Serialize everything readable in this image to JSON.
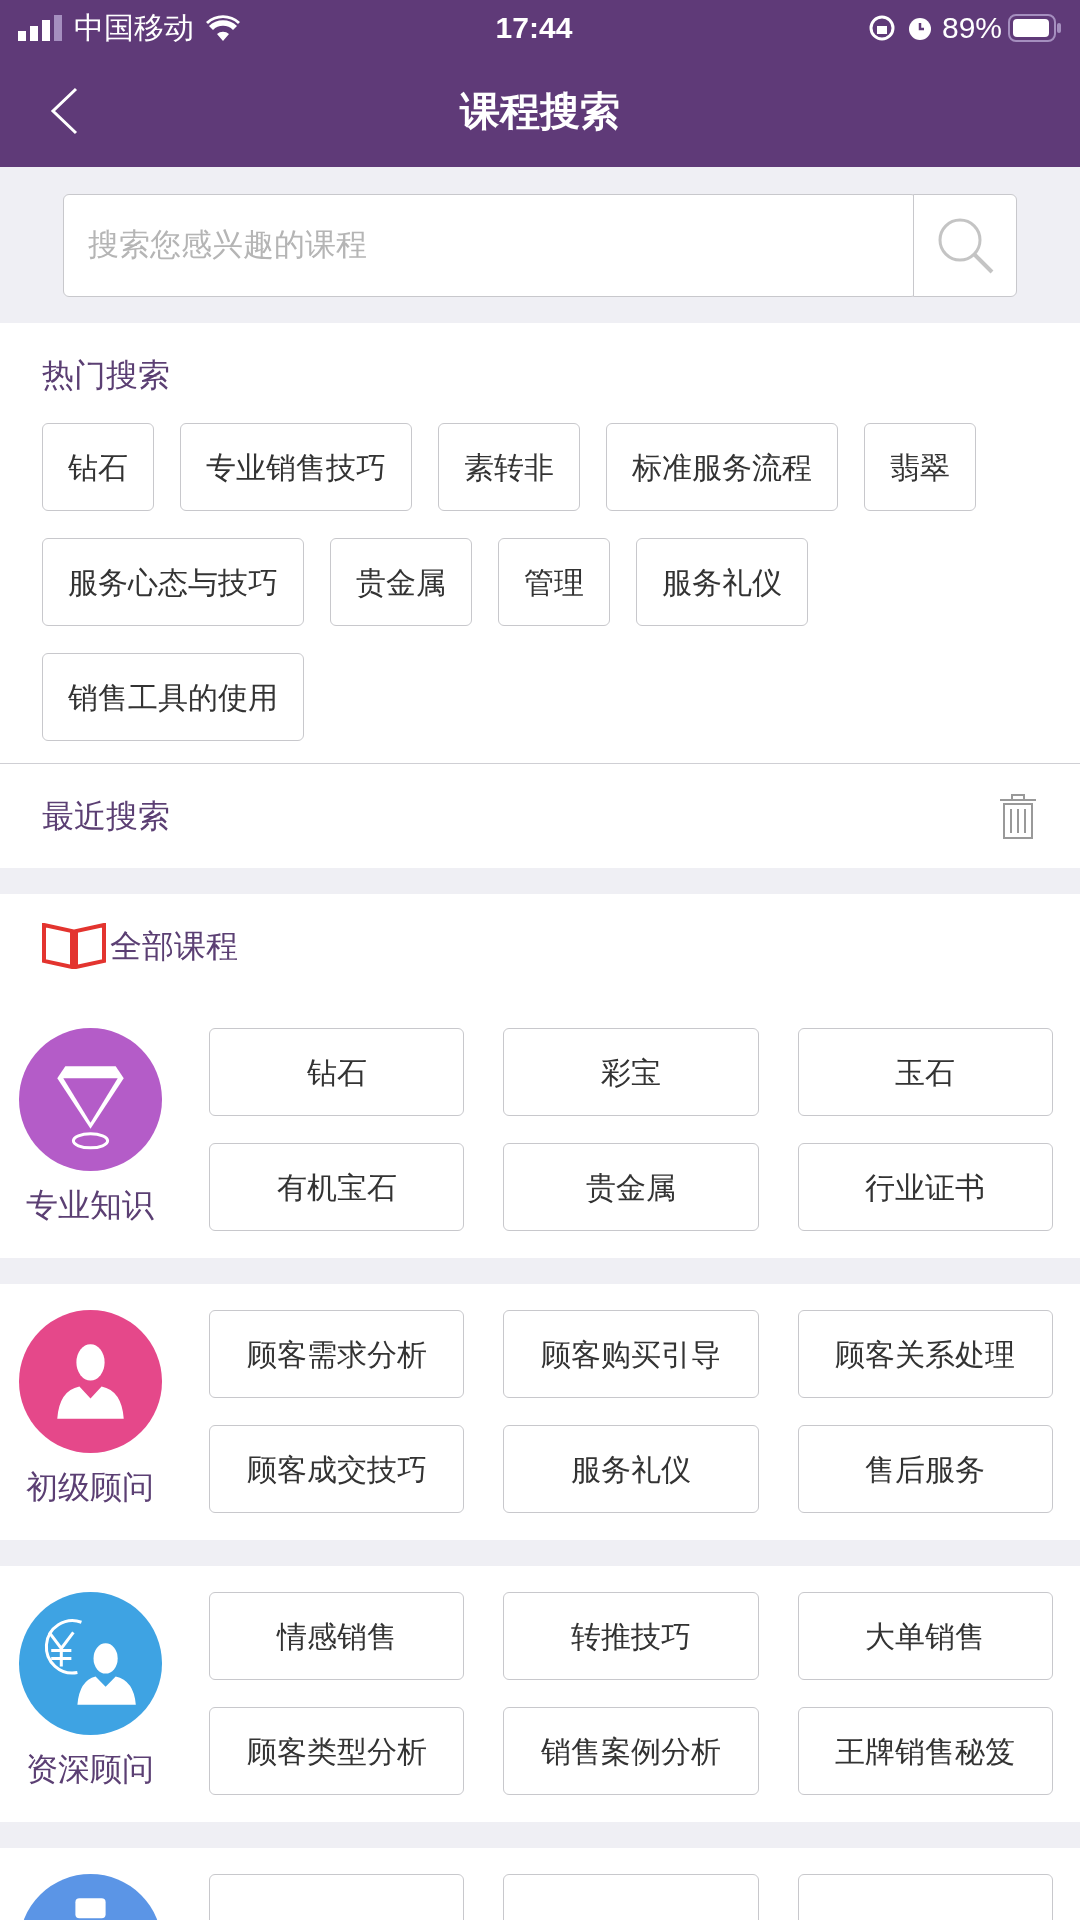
{
  "status_bar": {
    "carrier": "中国移动",
    "time": "17:44",
    "battery": "89%"
  },
  "nav": {
    "title": "课程搜索"
  },
  "search": {
    "placeholder": "搜索您感兴趣的课程"
  },
  "hot_search": {
    "title": "热门搜索",
    "tags": [
      "钻石",
      "专业销售技巧",
      "素转非",
      "标准服务流程",
      "翡翠",
      "服务心态与技巧",
      "贵金属",
      "管理",
      "服务礼仪",
      "销售工具的使用"
    ]
  },
  "recent_search": {
    "title": "最近搜索"
  },
  "all_courses": {
    "title": "全部课程",
    "categories": [
      {
        "kind": "diamond",
        "label": "专业知识",
        "color": "#b45cc8",
        "items": [
          "钻石",
          "彩宝",
          "玉石",
          "有机宝石",
          "贵金属",
          "行业证书"
        ]
      },
      {
        "kind": "person",
        "label": "初级顾问",
        "color": "#e5488a",
        "items": [
          "顾客需求分析",
          "顾客购买引导",
          "顾客关系处理",
          "顾客成交技巧",
          "服务礼仪",
          "售后服务"
        ]
      },
      {
        "kind": "money",
        "label": "资深顾问",
        "color": "#3ea3e3",
        "items": [
          "情感销售",
          "转推技巧",
          "大单销售",
          "顾客类型分析",
          "销售案例分析",
          "王牌销售秘笈"
        ]
      },
      {
        "kind": "partial",
        "color": "#5b95e6"
      }
    ]
  }
}
